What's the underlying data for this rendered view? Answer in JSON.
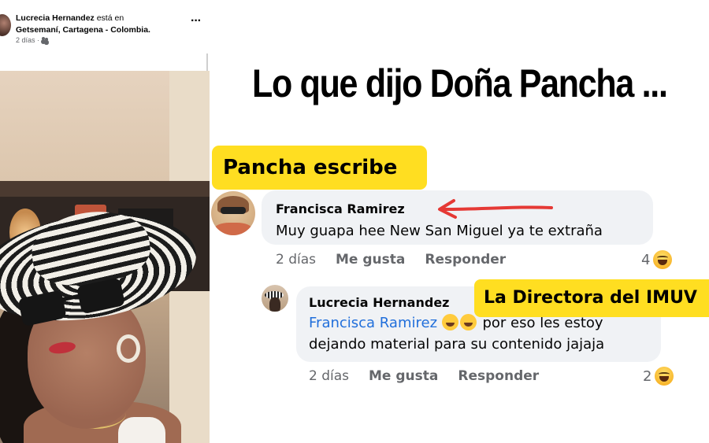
{
  "post": {
    "author": "Lucrecia Hernandez",
    "checkin_connector": "está en",
    "location": "Getsemaní, Cartagena - Colombia.",
    "time": "2 días ·",
    "audience_icon": "friends-icon",
    "more_icon": "more-icon"
  },
  "headline": "Lo que dijo Doña Pancha ...",
  "tags": {
    "pancha": "Pancha escribe",
    "directora": "La Directora del IMUV"
  },
  "comments": [
    {
      "author": "Francisca Ramirez",
      "text": "Muy guapa hee New San Miguel ya te extraña",
      "time": "2 días",
      "like_label": "Me gusta",
      "reply_label": "Responder",
      "reaction_count": "4",
      "reaction_icon": "haha-icon"
    },
    {
      "author": "Lucrecia Hernandez",
      "mention": "Francisca Ramirez",
      "emojis": "rofl-icon rofl-icon",
      "text": "por eso les estoy dejando material para su contenido jajaja",
      "time": "2 días",
      "like_label": "Me gusta",
      "reply_label": "Responder",
      "reaction_count": "2",
      "reaction_icon": "haha-icon"
    }
  ],
  "colors": {
    "tag_yellow": "#ffde21",
    "mention_blue": "#216fdb",
    "arrow_red": "#e53935",
    "bubble_gray": "#f0f2f5",
    "meta_gray": "#65676b"
  }
}
